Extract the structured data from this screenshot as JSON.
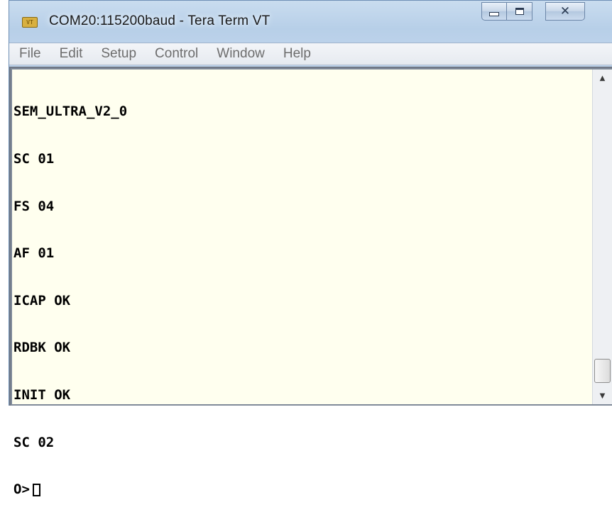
{
  "window": {
    "title": "COM20:115200baud - Tera Term VT",
    "app_icon_text": "VT"
  },
  "menubar": {
    "items": [
      "File",
      "Edit",
      "Setup",
      "Control",
      "Window",
      "Help"
    ]
  },
  "terminal": {
    "lines": [
      "SEM_ULTRA_V2_0",
      "SC 01",
      "FS 04",
      "AF 01",
      "ICAP OK",
      "RDBK OK",
      "INIT OK",
      "SC 02"
    ],
    "prompt": "O>"
  },
  "scrollbar": {
    "up_arrow": "▲",
    "down_arrow": "▼"
  },
  "colors": {
    "terminal_background": "#ffffef",
    "terminal_text": "#000000"
  }
}
